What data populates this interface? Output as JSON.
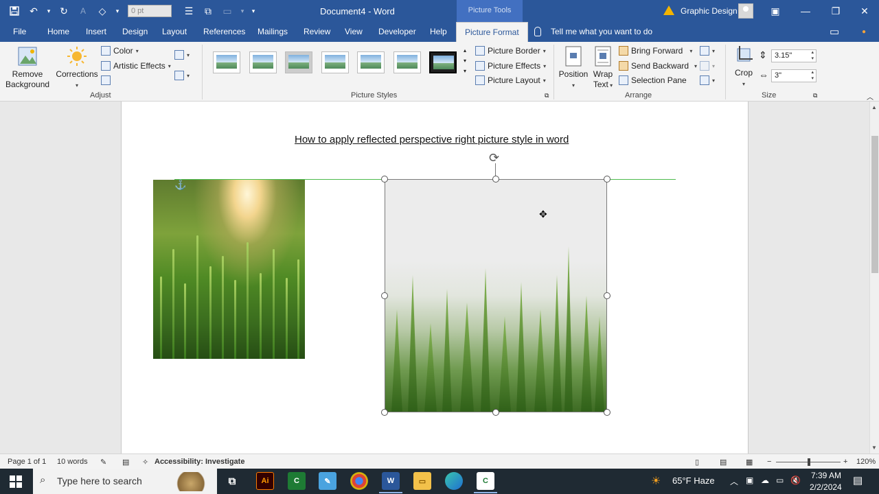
{
  "window": {
    "doc_title": "Document4  -  Word",
    "context_tab_group": "Picture Tools",
    "user_name": "Graphic Design",
    "font_size_placeholder": "0 pt"
  },
  "tabs": [
    "File",
    "Home",
    "Insert",
    "Design",
    "Layout",
    "References",
    "Mailings",
    "Review",
    "View",
    "Developer",
    "Help",
    "Picture Format"
  ],
  "active_tab": "Picture Format",
  "tell_me": "Tell me what you want to do",
  "ribbon": {
    "adjust": {
      "remove_background_l1": "Remove",
      "remove_background_l2": "Background",
      "corrections": "Corrections",
      "color": "Color",
      "artistic_effects": "Artistic Effects",
      "group_label": "Adjust"
    },
    "picture_styles": {
      "picture_border": "Picture Border",
      "picture_effects": "Picture Effects",
      "picture_layout": "Picture Layout",
      "group_label": "Picture Styles"
    },
    "arrange": {
      "position": "Position",
      "wrap_text_l1": "Wrap",
      "wrap_text_l2": "Text",
      "bring_forward": "Bring Forward",
      "send_backward": "Send Backward",
      "selection_pane": "Selection Pane",
      "group_label": "Arrange"
    },
    "size": {
      "crop": "Crop",
      "height": "3.15\"",
      "width": "3\"",
      "group_label": "Size"
    }
  },
  "document": {
    "heading": "How to apply reflected perspective right picture style in word"
  },
  "status": {
    "page": "Page 1 of 1",
    "words": "10 words",
    "accessibility": "Accessibility: Investigate",
    "zoom": "120%"
  },
  "taskbar": {
    "search_placeholder": "Type here to search",
    "weather": "65°F  Haze",
    "time": "7:39 AM",
    "date": "2/2/2024"
  },
  "colors": {
    "word_blue": "#2b579a",
    "selection_guide": "#4cbb4c",
    "taskbar": "#1f2a33"
  }
}
